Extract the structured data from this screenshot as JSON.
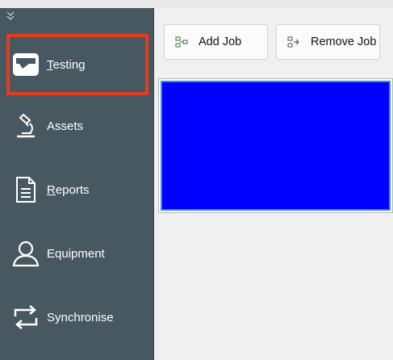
{
  "sidebar": {
    "collapse_icon": "double-chevron-down-icon",
    "items": [
      {
        "label_first": "T",
        "label_rest": "esting",
        "icon": "testing-icon",
        "active": true
      },
      {
        "label": "Assets",
        "icon": "microscope-icon"
      },
      {
        "label_first": "R",
        "label_rest": "eports",
        "icon": "document-icon"
      },
      {
        "label": "Equipment",
        "icon": "person-icon"
      },
      {
        "label": "Synchronise",
        "icon": "sync-arrows-icon"
      }
    ]
  },
  "toolbar": {
    "add_job_label": "Add Job",
    "remove_job_label": "Remove Job"
  },
  "colors": {
    "sidebar_bg": "#475861",
    "active_outline": "#e53b1f",
    "panel_fill": "#0000ff"
  }
}
